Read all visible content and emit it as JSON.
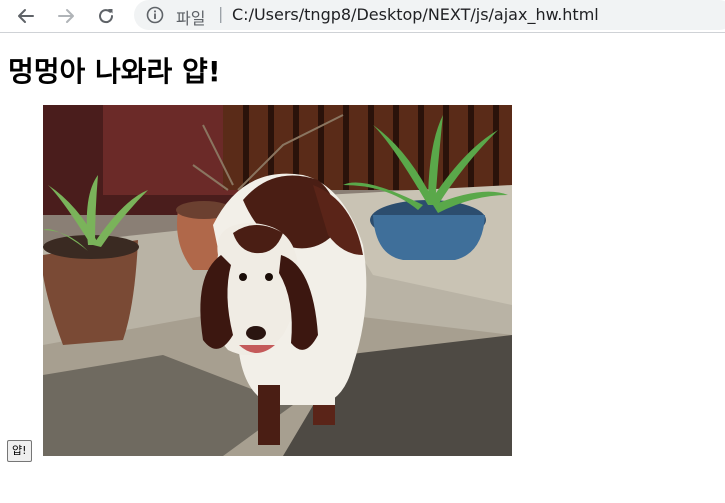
{
  "browser": {
    "scheme_label": "파일",
    "separator": "|",
    "url": "C:/Users/tngp8/Desktop/NEXT/js/ajax_hw.html",
    "icons": {
      "back": "arrow-left",
      "forward": "arrow-right",
      "reload": "reload",
      "site_info": "info-circle"
    }
  },
  "page": {
    "heading": "멍멍아 나와라 얍!",
    "button_label": "얍!",
    "image": {
      "subject": "dog-photo"
    }
  },
  "colors": {
    "toolbar_bg": "#ffffff",
    "omnibox_bg": "#f1f3f4",
    "forward_disabled": "#b0b4b8"
  }
}
